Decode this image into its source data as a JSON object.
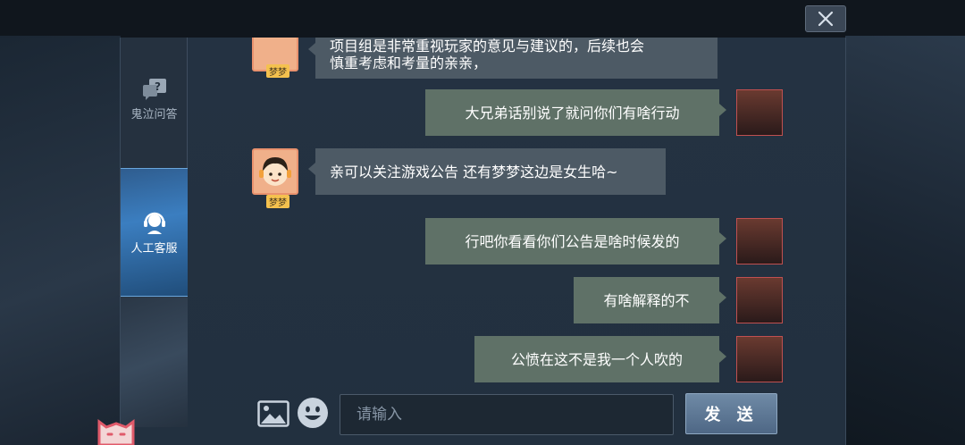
{
  "window": {
    "close_icon": "close-x-icon"
  },
  "sidebar": {
    "items": [
      {
        "label": "鬼泣问答",
        "icon": "question-chat-icon",
        "active": false
      },
      {
        "label": "人工客服",
        "icon": "headset-agent-icon",
        "active": true
      }
    ]
  },
  "chat": {
    "messages": [
      {
        "sender": "bot",
        "name": "梦梦",
        "lines": [
          "项目组是非常重视玩家的意见与建议的，后续也会",
          "慎重考虑和考量的亲亲，"
        ]
      },
      {
        "sender": "user",
        "text": "大兄弟话别说了就问你们有啥行动"
      },
      {
        "sender": "bot",
        "name": "梦梦",
        "text": "亲可以关注游戏公告 还有梦梦这边是女生哈~"
      },
      {
        "sender": "user",
        "text": "行吧你看看你们公告是啥时候发的"
      },
      {
        "sender": "user",
        "text": "有啥解释的不"
      },
      {
        "sender": "user",
        "text": "公愤在这不是我一个人吹的"
      }
    ]
  },
  "input": {
    "placeholder": "请输入",
    "value": "",
    "image_icon": "image-icon",
    "emoji_icon": "smiley-emoji-icon"
  },
  "send_button": {
    "label": "发 送"
  },
  "colors": {
    "bot_bubble": "#4d5a65",
    "user_bubble": "#5f7167",
    "active_tab": "#3b7ec0",
    "bot_name_badge": "#f4c14e"
  }
}
